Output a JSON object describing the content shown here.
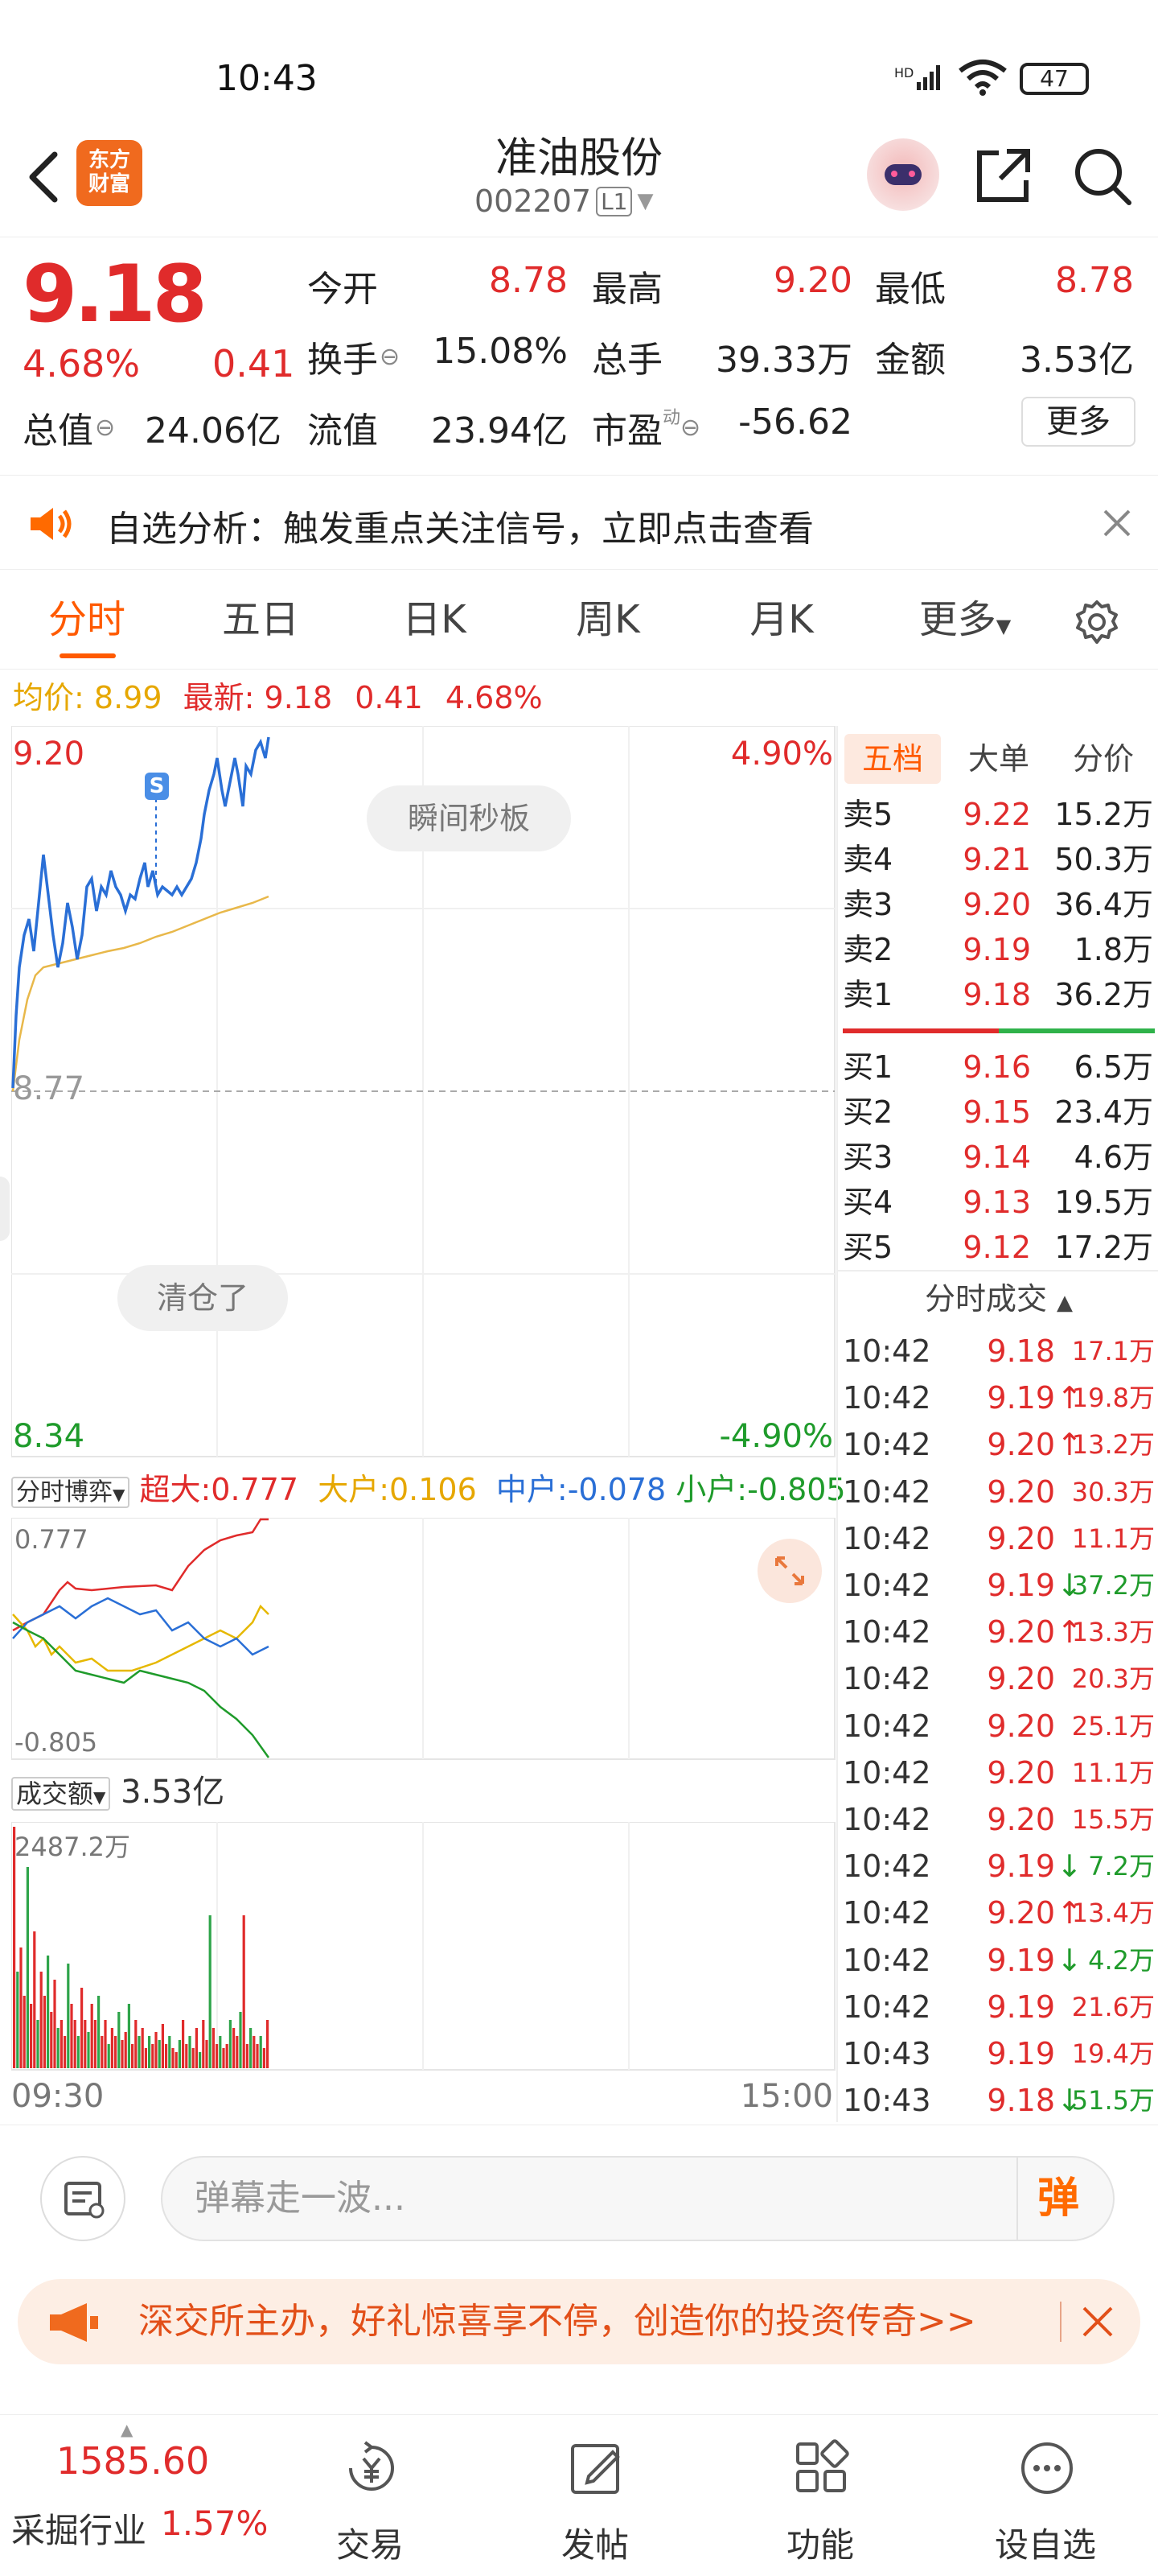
{
  "status": {
    "time": "10:43",
    "battery": "47"
  },
  "header": {
    "title": "准油股份",
    "code": "002207",
    "level": "L1",
    "logo_text": "东方财富"
  },
  "quote": {
    "price": "9.18",
    "change_pct": "4.68%",
    "change": "0.41",
    "open_label": "今开",
    "open": "8.78",
    "high_label": "最高",
    "high": "9.20",
    "low_label": "最低",
    "low": "8.78",
    "turnover_label": "换手",
    "turnover": "15.08%",
    "volume_label": "总手",
    "volume": "39.33万",
    "amount_label": "金额",
    "amount": "3.53亿",
    "mktcap_label": "总值",
    "mktcap": "24.06亿",
    "float_label": "流值",
    "float": "23.94亿",
    "pe_label": "市盈",
    "pe_sup": "动",
    "pe": "-56.62",
    "more_button": "更多"
  },
  "notice": {
    "text": "自选分析：触发重点关注信号，立即点击查看"
  },
  "tabs": [
    "分时",
    "五日",
    "日K",
    "周K",
    "月K",
    "更多"
  ],
  "avg_line": {
    "avg_label": "均价:",
    "avg": "8.99",
    "latest_label": "最新:",
    "latest": "9.18",
    "chg": "0.41",
    "pct": "4.68%"
  },
  "chart": {
    "max_price": "9.20",
    "max_pct": "4.90%",
    "base_price": "8.77",
    "min_price": "8.34",
    "min_pct": "-4.90%",
    "bubble1": "瞬间秒板",
    "bubble2": "清仓了",
    "marker": "S",
    "game_label": "分时博弈",
    "super_label": "超大:",
    "super_val": "0.777",
    "big_label": "大户:",
    "big_val": "0.106",
    "mid_label": "中户:",
    "mid_val": "-0.078",
    "small_label": "小户:",
    "small_val": "-0.805",
    "game_max": "0.777",
    "game_min": "-0.805",
    "vol_label": "成交额",
    "vol_total": "3.53亿",
    "vol_max": "2487.2万",
    "time_start": "09:30",
    "time_end": "15:00"
  },
  "orderbook": {
    "tabs": [
      "五档",
      "大单",
      "分价"
    ],
    "sells": [
      {
        "label": "卖5",
        "price": "9.22",
        "vol": "15.2万"
      },
      {
        "label": "卖4",
        "price": "9.21",
        "vol": "50.3万"
      },
      {
        "label": "卖3",
        "price": "9.20",
        "vol": "36.4万"
      },
      {
        "label": "卖2",
        "price": "9.19",
        "vol": "1.8万"
      },
      {
        "label": "卖1",
        "price": "9.18",
        "vol": "36.2万"
      }
    ],
    "buys": [
      {
        "label": "买1",
        "price": "9.16",
        "vol": "6.5万"
      },
      {
        "label": "买2",
        "price": "9.15",
        "vol": "23.4万"
      },
      {
        "label": "买3",
        "price": "9.14",
        "vol": "4.6万"
      },
      {
        "label": "买4",
        "price": "9.13",
        "vol": "19.5万"
      },
      {
        "label": "买5",
        "price": "9.12",
        "vol": "17.2万"
      }
    ]
  },
  "ticks": {
    "title": "分时成交",
    "rows": [
      {
        "time": "10:42",
        "price": "9.18",
        "arrow": "",
        "vol": "17.1万",
        "color": "red"
      },
      {
        "time": "10:42",
        "price": "9.19",
        "arrow": "↑",
        "vol": "19.8万",
        "color": "red"
      },
      {
        "time": "10:42",
        "price": "9.20",
        "arrow": "↑",
        "vol": "13.2万",
        "color": "red"
      },
      {
        "time": "10:42",
        "price": "9.20",
        "arrow": "",
        "vol": "30.3万",
        "color": "red"
      },
      {
        "time": "10:42",
        "price": "9.20",
        "arrow": "",
        "vol": "11.1万",
        "color": "red"
      },
      {
        "time": "10:42",
        "price": "9.19",
        "arrow": "↓",
        "vol": "37.2万",
        "color": "green"
      },
      {
        "time": "10:42",
        "price": "9.20",
        "arrow": "↑",
        "vol": "13.3万",
        "color": "red"
      },
      {
        "time": "10:42",
        "price": "9.20",
        "arrow": "",
        "vol": "20.3万",
        "color": "red"
      },
      {
        "time": "10:42",
        "price": "9.20",
        "arrow": "",
        "vol": "25.1万",
        "color": "red"
      },
      {
        "time": "10:42",
        "price": "9.20",
        "arrow": "",
        "vol": "11.1万",
        "color": "red"
      },
      {
        "time": "10:42",
        "price": "9.20",
        "arrow": "",
        "vol": "15.5万",
        "color": "red"
      },
      {
        "time": "10:42",
        "price": "9.19",
        "arrow": "↓",
        "vol": "7.2万",
        "color": "green"
      },
      {
        "time": "10:42",
        "price": "9.20",
        "arrow": "↑",
        "vol": "13.4万",
        "color": "red"
      },
      {
        "time": "10:42",
        "price": "9.19",
        "arrow": "↓",
        "vol": "4.2万",
        "color": "green"
      },
      {
        "time": "10:42",
        "price": "9.19",
        "arrow": "",
        "vol": "21.6万",
        "color": "red"
      },
      {
        "time": "10:43",
        "price": "9.19",
        "arrow": "",
        "vol": "19.4万",
        "color": "red"
      },
      {
        "time": "10:43",
        "price": "9.18",
        "arrow": "↓",
        "vol": "51.5万",
        "color": "green"
      }
    ]
  },
  "input": {
    "placeholder": "弹幕走一波...",
    "danmu_button": "弹"
  },
  "banner": {
    "text": "深交所主办，好礼惊喜享不停，创造你的投资传奇>>"
  },
  "bottom": {
    "index_value": "1585.60",
    "index_name": "采掘行业",
    "index_pct": "1.57%",
    "nav": [
      "交易",
      "发帖",
      "功能",
      "设自选"
    ]
  }
}
